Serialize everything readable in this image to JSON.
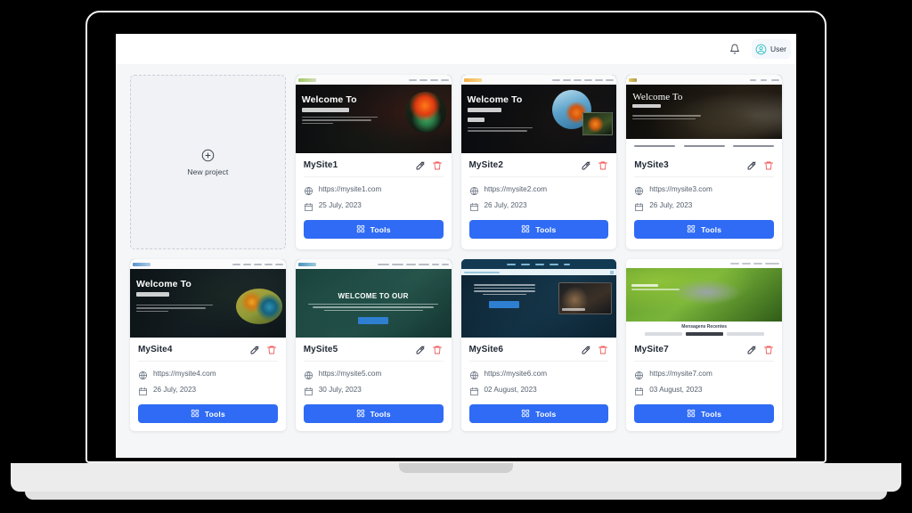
{
  "app": {
    "accent_color": "#2f6bf4",
    "danger_color": "#f15b5b",
    "page_background": "#f4f6f8"
  },
  "topbar": {
    "notifications_icon": "bell-icon",
    "user": {
      "avatar_icon": "user-avatar-icon",
      "name": "User"
    }
  },
  "new_project": {
    "icon": "plus-circle-icon",
    "label": "New project"
  },
  "card_labels": {
    "tools": "Tools",
    "tools_icon": "grid-icon",
    "edit_icon": "edit-pencil-icon",
    "delete_icon": "trash-icon",
    "url_icon": "globe-icon",
    "date_icon": "calendar-icon"
  },
  "projects": [
    {
      "title": "MySite1",
      "url": "https://mysite1.com",
      "date": "25 July, 2023",
      "hero_heading": "Welcome To",
      "theme": "plants"
    },
    {
      "title": "MySite2",
      "url": "https://mysite2.com",
      "date": "26 July, 2023",
      "hero_heading": "Welcome To",
      "theme": "goldfish"
    },
    {
      "title": "MySite3",
      "url": "https://mysite3.com",
      "date": "26 July, 2023",
      "hero_heading": "Welcome To",
      "theme": "reptile"
    },
    {
      "title": "MySite4",
      "url": "https://mysite4.com",
      "date": "26 July, 2023",
      "hero_heading": "Welcome To",
      "theme": "hummingbird"
    },
    {
      "title": "MySite5",
      "url": "https://mysite5.com",
      "date": "30 July, 2023",
      "hero_heading": "WELCOME TO OUR",
      "theme": "cleaning"
    },
    {
      "title": "MySite6",
      "url": "https://mysite6.com",
      "date": "02 August, 2023",
      "hero_heading": "",
      "theme": "services"
    },
    {
      "title": "MySite7",
      "url": "https://mysite7.com",
      "date": "03 August, 2023",
      "hero_heading": "",
      "theme": "pigeon",
      "section_title": "Mensagens Recentes"
    }
  ]
}
